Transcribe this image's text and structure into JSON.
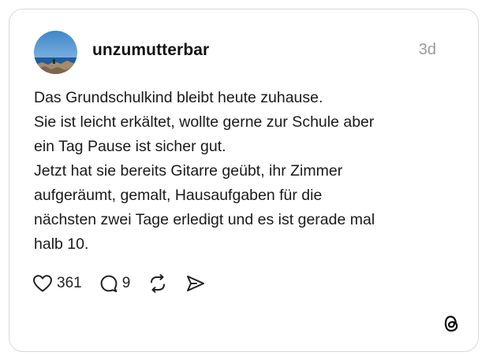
{
  "post": {
    "username": "unzumutterbar",
    "time": "3d",
    "lines": [
      "Das Grundschulkind bleibt heute zuhause.",
      "Sie ist leicht erkältet, wollte gerne zur Schule aber",
      "ein Tag Pause ist sicher gut.",
      "Jetzt hat sie bereits Gitarre geübt, ihr Zimmer",
      "aufgeräumt, gemalt, Hausaufgaben für die",
      "nächsten zwei Tage erledigt und es ist gerade mal",
      "halb 10."
    ]
  },
  "actions": {
    "like_count": "361",
    "reply_count": "9",
    "like_icon": "heart-icon",
    "reply_icon": "speech-bubble-icon",
    "repost_icon": "repost-icon",
    "share_icon": "send-icon"
  },
  "brand": {
    "logo_icon": "threads-logo-icon"
  },
  "colors": {
    "text": "#111111",
    "muted": "#999999",
    "border": "#d9d9d9"
  }
}
